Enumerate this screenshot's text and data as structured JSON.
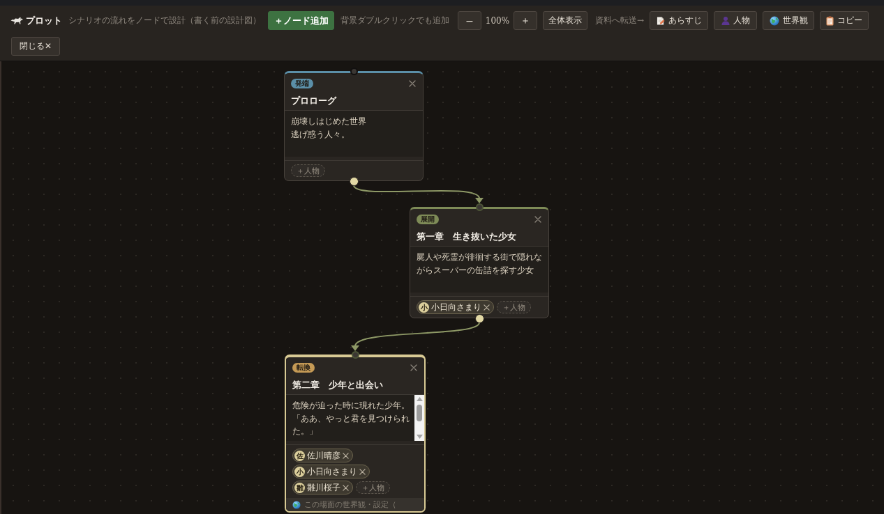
{
  "toolbar": {
    "title": "プロット",
    "subtitle": "シナリオの流れをノードで設計（書く前の設計図）",
    "add_button": "＋ノード追加",
    "add_hint": "背景ダブルクリックでも追加",
    "zoom_out": "−",
    "zoom_level": "100%",
    "zoom_in": "＋",
    "fit_button": "全体表示",
    "transfer_label": "資料へ転送→",
    "transfer_buttons": [
      {
        "kind": "synopsis",
        "label": "あらすじ"
      },
      {
        "kind": "characters",
        "label": "人物"
      },
      {
        "kind": "world",
        "label": "世界観"
      },
      {
        "kind": "copy",
        "label": "コピー"
      }
    ],
    "close_button": "閉じる✕"
  },
  "nodes": [
    {
      "stage": "発端",
      "color": "#5b8fa8",
      "title": "プロローグ",
      "description_lines": [
        "崩壊しはじめた世界",
        "逃げ惑う人々。"
      ],
      "selected": false,
      "connected": false,
      "scrollbar": false,
      "add_character": "＋人物"
    },
    {
      "stage": "展開",
      "color": "#7e8b57",
      "title": "第一章　生き抜いた少女",
      "description_lines": [
        "屍人や死霊が徘徊する街で隠れながらスーパーの缶詰を探す少女"
      ],
      "selected": false,
      "connected": true,
      "scrollbar": false,
      "characters": [
        {
          "initial": "小",
          "name": "小日向さまり"
        }
      ],
      "add_character": "＋人物"
    },
    {
      "stage": "転換",
      "color": "#c59a55",
      "title": "第二章　少年と出会い",
      "description_lines": [
        "危険が迫った時に現れた少年。「ああ、やっと君を見つけられた。」"
      ],
      "selected": true,
      "connected": true,
      "scrollbar": true,
      "characters": [
        {
          "initial": "佐",
          "name": "佐川晴彦"
        },
        {
          "initial": "小",
          "name": "小日向さまり"
        },
        {
          "initial": "雛",
          "name": "雛川桜子"
        }
      ],
      "add_character": "＋人物",
      "world_setting": "この場面の世界観・設定（"
    }
  ]
}
